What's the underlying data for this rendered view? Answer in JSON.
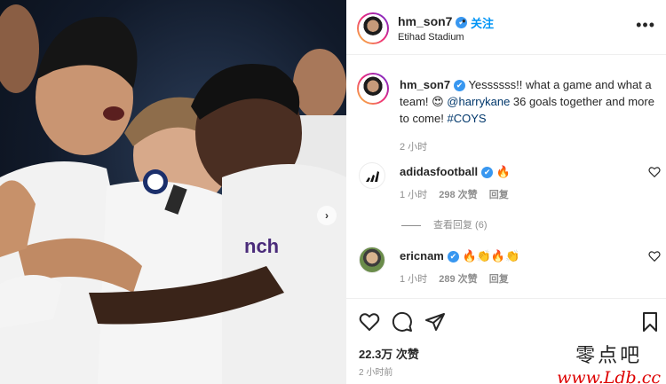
{
  "post": {
    "username": "hm_son7",
    "verified_glyph": "✔",
    "follow_label": "关注",
    "separator": "•",
    "location": "Etihad Stadium",
    "more_glyph": "•••"
  },
  "caption": {
    "username": "hm_son7",
    "text_before": " Yessssss!! what a game and what a team! 😍 ",
    "mention": "@harrykane",
    "text_after": " 36 goals together and more to come! ",
    "hashtag": "#COYS",
    "time": "2 小时"
  },
  "comments": [
    {
      "username": "adidasfootball",
      "text": "🔥",
      "time": "1 小时",
      "likes": "298 次赞",
      "reply": "回复"
    },
    {
      "username": "ericnam",
      "text": "🔥👏🔥👏",
      "time": "1 小时",
      "likes": "289 次赞",
      "reply": "回复"
    }
  ],
  "view_replies": "查看回复 (6)",
  "icons": [
    "heart-icon",
    "comment-icon",
    "share-icon",
    "bookmark-icon",
    "carousel-next-icon",
    "more-icon",
    "verified-icon"
  ],
  "engagement": {
    "likes": "22.3万 次赞",
    "ago": "2 小时前"
  },
  "watermark": {
    "chinese": "零点吧",
    "url": "www.Ldb.cc"
  },
  "colors": {
    "accent": "#0095f6",
    "verified": "#3897f0",
    "muted": "#8e8e8e"
  }
}
